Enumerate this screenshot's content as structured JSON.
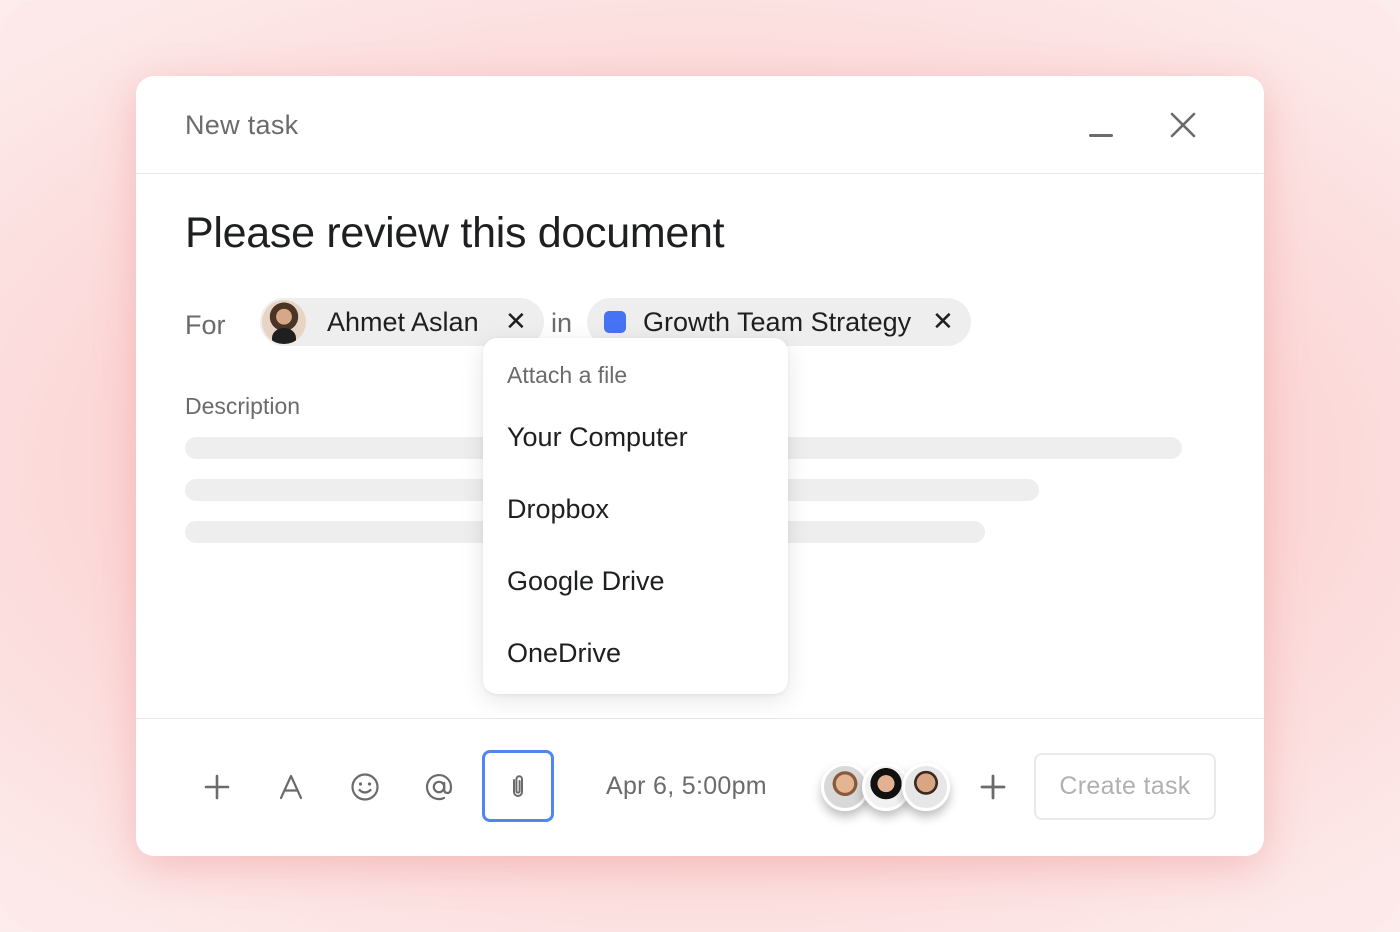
{
  "header": {
    "title": "New task"
  },
  "task": {
    "title": "Please review this document"
  },
  "meta": {
    "for_label": "For",
    "assignee": "Ahmet Aslan",
    "in_label": "in",
    "project": "Growth Team Strategy",
    "remove_glyph": "✕",
    "project_color": "#4573F3"
  },
  "description": {
    "label": "Description"
  },
  "attach_menu": {
    "heading": "Attach a file",
    "items": [
      "Your Computer",
      "Dropbox",
      "Google Drive",
      "OneDrive"
    ]
  },
  "footer": {
    "due_date": "Apr 6, 5:00pm",
    "create_label": "Create task"
  },
  "colors": {
    "accent": "#4F86F0"
  }
}
